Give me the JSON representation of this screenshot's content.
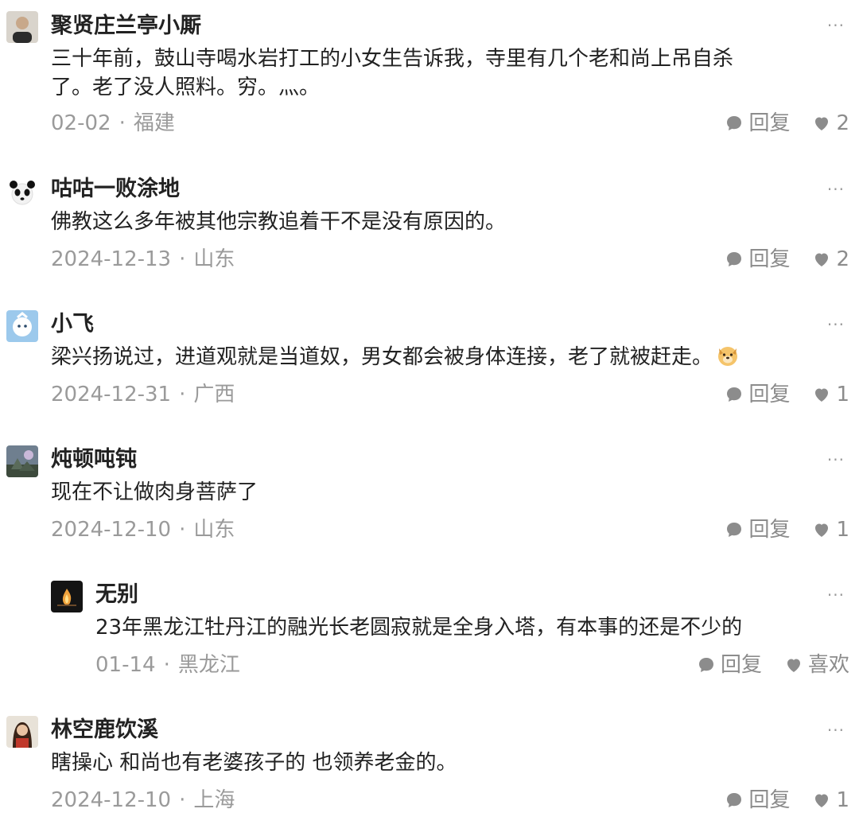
{
  "comments": [
    {
      "name": "聚贤庄兰亭小厮",
      "text": "三十年前，鼓山寺喝水岩打工的小女生告诉我，寺里有几个老和尚上吊自杀\n了。老了没人照料。穷。灬。",
      "date": "02-02",
      "location": "福建",
      "reply_label": "回复",
      "likes": "2",
      "more": "···"
    },
    {
      "name": "咕咕一败涂地",
      "text": "佛教这么多年被其他宗教追着干不是没有原因的。",
      "date": "2024-12-13",
      "location": "山东",
      "reply_label": "回复",
      "likes": "2",
      "more": "···"
    },
    {
      "name": "小飞",
      "text": "梁兴扬说过，进道观就是当道奴，男女都会被身体连接，老了就被赶走。",
      "date": "2024-12-31",
      "location": "广西",
      "reply_label": "回复",
      "likes": "1",
      "more": "···"
    },
    {
      "name": "炖顿吨钝",
      "text": "现在不让做肉身菩萨了",
      "date": "2024-12-10",
      "location": "山东",
      "reply_label": "回复",
      "likes": "1",
      "more": "···"
    },
    {
      "name": "无别",
      "text": "23年黑龙江牡丹江的融光长老圆寂就是全身入塔，有本事的还是不少的",
      "date": "01-14",
      "location": "黑龙江",
      "reply_label": "回复",
      "likes": "喜欢",
      "more": "···"
    },
    {
      "name": "林空鹿饮溪",
      "text": "瞎操心 和尚也有老婆孩子的 也领养老金的。",
      "date": "2024-12-10",
      "location": "上海",
      "reply_label": "回复",
      "likes": "1",
      "more": "···"
    }
  ],
  "meta_separator": "·",
  "icons": {
    "reply": "speech-bubble-icon",
    "like": "heart-icon",
    "more": "more-dots-icon",
    "emoji": "dog-emoji-icon"
  },
  "colors": {
    "text": "#222222",
    "meta": "#9a9a9a",
    "icon": "#8c8c8c"
  }
}
